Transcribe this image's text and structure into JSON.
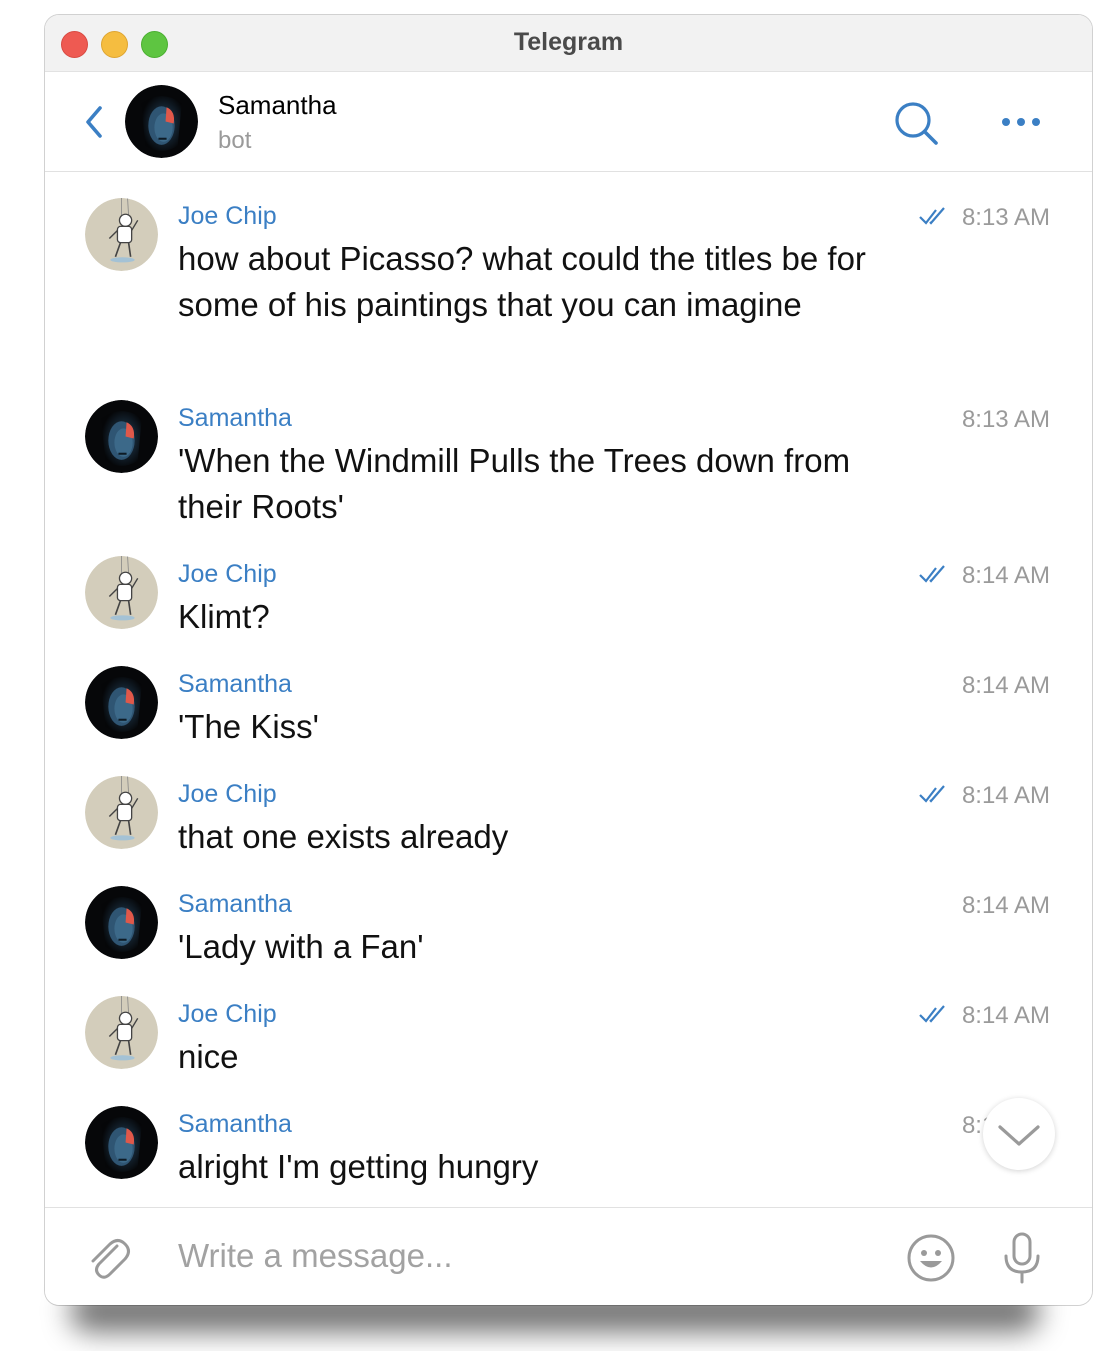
{
  "window": {
    "title": "Telegram"
  },
  "header": {
    "name": "Samantha",
    "status": "bot"
  },
  "colors": {
    "accent": "#3b7fc4",
    "time": "#9a9a9a",
    "text": "#111111"
  },
  "messages": [
    {
      "sender": "Joe Chip",
      "avatar": "astronaut-avatar",
      "text": "how about Picasso? what could the titles be for some of his paintings that you can imagine",
      "time": "8:13 AM",
      "read": true
    },
    {
      "sender": "Samantha",
      "avatar": "woman-portrait-avatar",
      "text": "'When the Windmill Pulls the Trees down from their Roots'",
      "time": "8:13 AM",
      "read": false
    },
    {
      "sender": "Joe Chip",
      "avatar": "astronaut-avatar",
      "text": "Klimt?",
      "time": "8:14 AM",
      "read": true
    },
    {
      "sender": "Samantha",
      "avatar": "woman-portrait-avatar",
      "text": "'The Kiss'",
      "time": "8:14 AM",
      "read": false
    },
    {
      "sender": "Joe Chip",
      "avatar": "astronaut-avatar",
      "text": "that one exists already",
      "time": "8:14 AM",
      "read": true
    },
    {
      "sender": "Samantha",
      "avatar": "woman-portrait-avatar",
      "text": "'Lady with a Fan'",
      "time": "8:14 AM",
      "read": false
    },
    {
      "sender": "Joe Chip",
      "avatar": "astronaut-avatar",
      "text": "nice",
      "time": "8:14 AM",
      "read": true
    },
    {
      "sender": "Samantha",
      "avatar": "woman-portrait-avatar",
      "text": "alright I'm getting hungry",
      "time": "8:14 AM",
      "read": false
    }
  ],
  "composer": {
    "placeholder": "Write a message...",
    "value": ""
  },
  "icons": {
    "back": "chevron-left-icon",
    "search": "search-icon",
    "more": "ellipsis-icon",
    "attach": "paperclip-icon",
    "emoji": "smiley-icon",
    "mic": "microphone-icon",
    "scroll": "chevron-down-icon",
    "read": "double-check-icon"
  }
}
